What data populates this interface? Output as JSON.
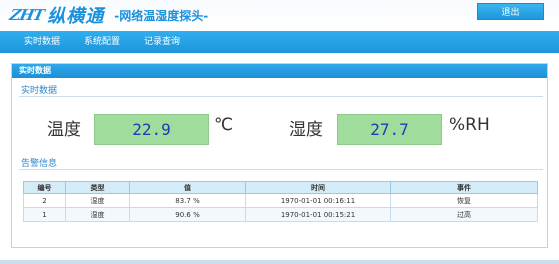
{
  "header": {
    "logo_mark": "ZHT",
    "logo_brand": "纵横通",
    "product_name": "-网络温湿度探头-",
    "logout_label": "退出"
  },
  "nav": {
    "items": [
      {
        "label": "实时数据"
      },
      {
        "label": "系统配置"
      },
      {
        "label": "记录查询"
      }
    ]
  },
  "panel": {
    "title": "实时数据",
    "realtime_section": "实时数据",
    "alarm_section": "告警信息"
  },
  "readings": {
    "temperature": {
      "label": "温度",
      "value": "22.9",
      "unit": "℃"
    },
    "humidity": {
      "label": "湿度",
      "value": "27.7",
      "unit": "%RH"
    }
  },
  "alarm_table": {
    "columns": [
      "编号",
      "类型",
      "值",
      "时间",
      "事件"
    ],
    "rows": [
      {
        "id": "2",
        "type": "湿度",
        "value": "83.7 %",
        "time": "1970-01-01 00:16:11",
        "event": "恢复"
      },
      {
        "id": "1",
        "type": "湿度",
        "value": "90.6 %",
        "time": "1970-01-01 00:15:21",
        "event": "过高"
      }
    ]
  },
  "colors": {
    "accent": "#1d95da",
    "reading_bg": "#a0dc9c",
    "reading_text": "#2637b4"
  }
}
